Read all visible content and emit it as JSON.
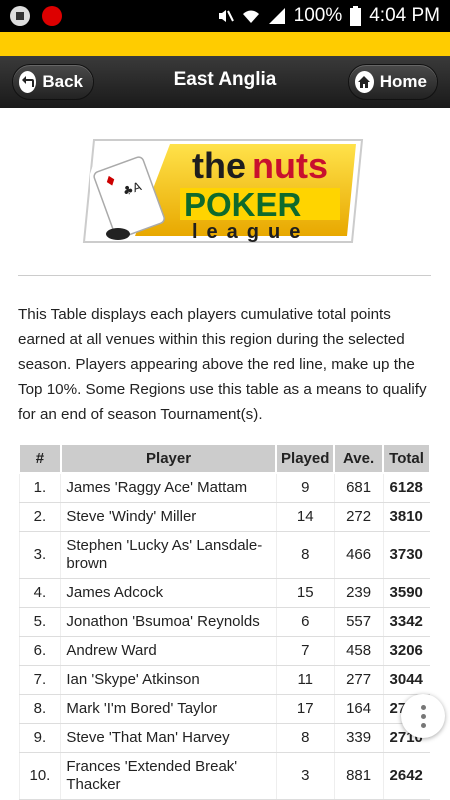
{
  "status_bar": {
    "battery": "100%",
    "time": "4:04 PM"
  },
  "header": {
    "title": "East Anglia",
    "back_label": "Back",
    "home_label": "Home"
  },
  "logo": {
    "line1a": "the",
    "line1b": "nuts",
    "line2": "POKER",
    "line3": "league"
  },
  "description": "This Table displays each players cumulative total points earned at all venues within this region during the selected season. Players appearing above the red line, make up the Top 10%. Some Regions use this table as a means to qualify for an end of season Tournament(s).",
  "table": {
    "headers": [
      "#",
      "Player",
      "Played",
      "Ave.",
      "Total"
    ],
    "rows": [
      [
        "1.",
        "James 'Raggy Ace' Mattam",
        "9",
        "681",
        "6128"
      ],
      [
        "2.",
        "Steve 'Windy' Miller",
        "14",
        "272",
        "3810"
      ],
      [
        "3.",
        "Stephen 'Lucky As' Lansdale-brown",
        "8",
        "466",
        "3730"
      ],
      [
        "4.",
        "James Adcock",
        "15",
        "239",
        "3590"
      ],
      [
        "5.",
        "Jonathon 'Bsumoa' Reynolds",
        "6",
        "557",
        "3342"
      ],
      [
        "6.",
        "Andrew Ward",
        "7",
        "458",
        "3206"
      ],
      [
        "7.",
        "Ian 'Skype' Atkinson",
        "11",
        "277",
        "3044"
      ],
      [
        "8.",
        "Mark 'I'm Bored' Taylor",
        "17",
        "164",
        "2788"
      ],
      [
        "9.",
        "Steve 'That Man' Harvey",
        "8",
        "339",
        "2710"
      ],
      [
        "10.",
        "Frances 'Extended Break' Thacker",
        "3",
        "881",
        "2642"
      ]
    ]
  },
  "colors": {
    "accent_yellow": "#ffcc00",
    "header_dark": "#222222",
    "table_header": "#cccccc"
  }
}
